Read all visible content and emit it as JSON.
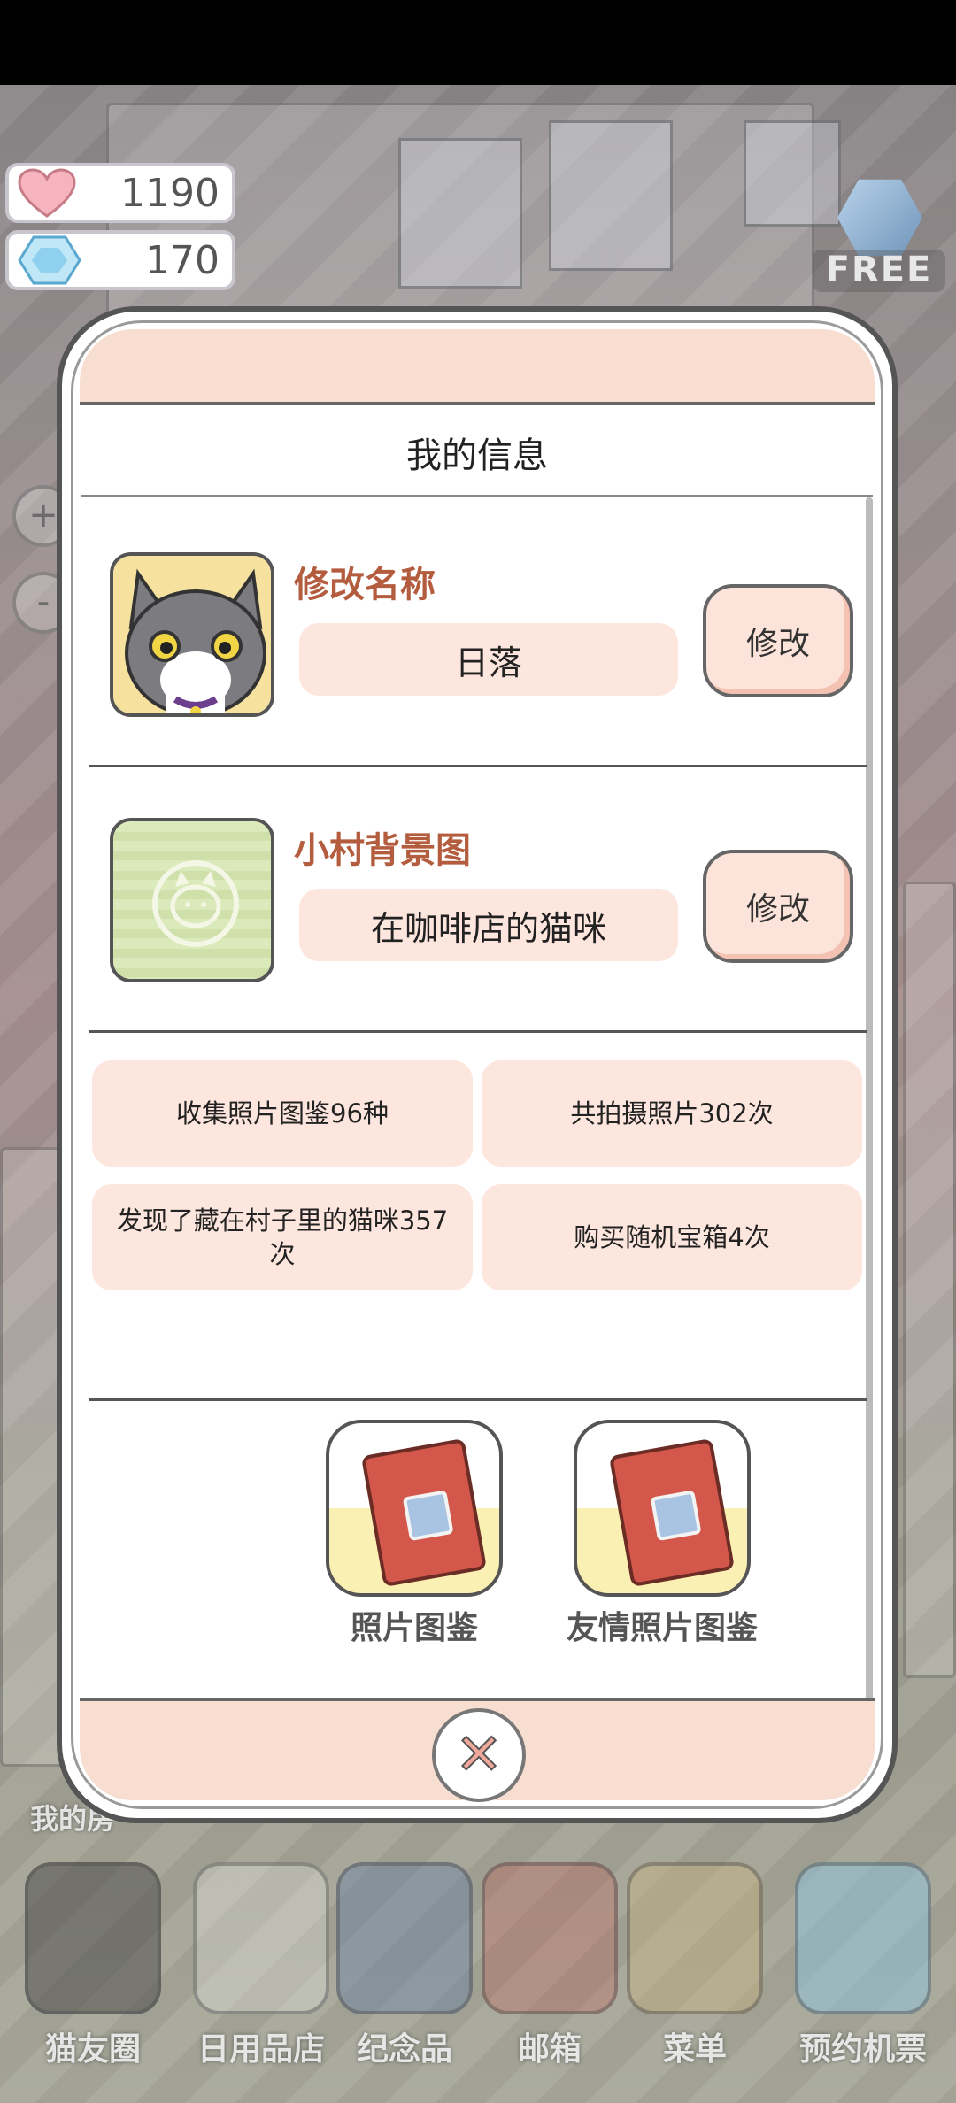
{
  "currency": {
    "hearts": "1190",
    "gems": "170",
    "free_label": "FREE"
  },
  "zoom": {
    "in": "+",
    "out": "-"
  },
  "modal": {
    "title": "我的信息",
    "name_section": {
      "label": "修改名称",
      "value": "日落",
      "button": "修改"
    },
    "background_section": {
      "label": "小村背景图",
      "value": "在咖啡店的猫咪",
      "button": "修改"
    },
    "stats": [
      "收集照片图鉴96种",
      "共拍摄照片302次",
      "发现了藏在村子里的猫咪357次",
      "购买随机宝箱4次"
    ],
    "albums": [
      {
        "label": "照片图鉴"
      },
      {
        "label": "友情照片图鉴"
      }
    ],
    "close_icon": "close-x"
  },
  "side_label": "我的房",
  "bottom_nav": [
    {
      "label": "猫友圈",
      "icon": "cat-camera-icon"
    },
    {
      "label": "日用品店",
      "icon": "fish-shop-icon"
    },
    {
      "label": "纪念品",
      "icon": "box-icon"
    },
    {
      "label": "邮箱",
      "icon": "mailbox-icon"
    },
    {
      "label": "菜单",
      "icon": "folder-paw-icon"
    },
    {
      "label": "预约机票",
      "icon": "airplane-icon"
    }
  ],
  "colors": {
    "accent_label": "#b45c3e",
    "card_bg": "#fde6dd",
    "header_band": "#f8ddd1"
  }
}
